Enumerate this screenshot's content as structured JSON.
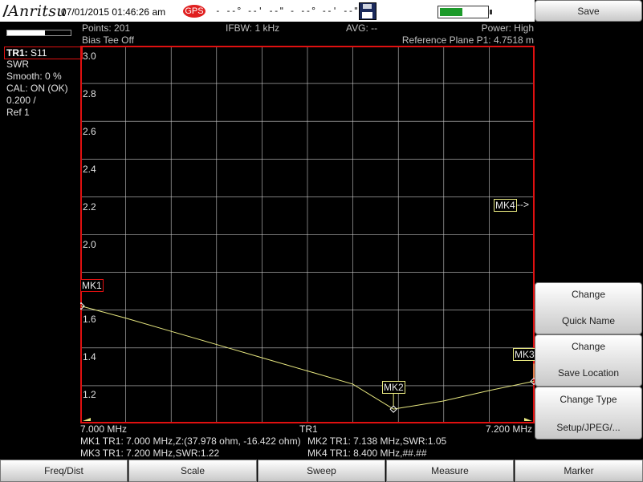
{
  "header": {
    "logo": "Anritsu",
    "datetime": "07/01/2015 01:46:26 am",
    "gps_label": "GPS",
    "coordinates": "- --° --' --\" - --° --' --\"",
    "battery_level": 0.5
  },
  "status": {
    "points": "Points: 201",
    "ifbw": "IFBW: 1 kHz",
    "avg": "AVG: --",
    "power": "Power: High",
    "bias_tee": "Bias Tee Off",
    "reference_plane": "Reference Plane P1: 4.7518 m",
    "progress": 0.6
  },
  "trace_info": {
    "trace": "TR1:",
    "param": "S11",
    "format": "SWR",
    "smooth": "Smooth: 0 %",
    "cal": "CAL: ON (OK)",
    "scale": "0.200 /",
    "ref": "Ref 1"
  },
  "chart_data": {
    "type": "line",
    "x": [
      7.0,
      7.02,
      7.04,
      7.06,
      7.08,
      7.1,
      7.12,
      7.138,
      7.16,
      7.18,
      7.2
    ],
    "series": [
      {
        "values": [
          1.62,
          1.555,
          1.485,
          1.415,
          1.345,
          1.275,
          1.205,
          1.072,
          1.115,
          1.17,
          1.22
        ]
      }
    ],
    "yticks": [
      "3.0",
      "2.8",
      "2.6",
      "2.4",
      "2.2",
      "2.0",
      "1.6",
      "1.4",
      "1.2"
    ],
    "ylim": [
      1.0,
      3.0
    ],
    "xlim": [
      7.0,
      7.2
    ],
    "x_start_label": "7.000 MHz",
    "x_end_label": "7.200 MHz",
    "trace_label": "TR1",
    "grid": true,
    "trace_color": "#e8e880",
    "grid_color": "#c8c8c8",
    "border_color": "#e01010"
  },
  "markers": {
    "mk1": {
      "label": "MK1",
      "x": 7.0,
      "y": 1.62
    },
    "mk2": {
      "label": "MK2",
      "x": 7.138,
      "y": 1.072
    },
    "mk3": {
      "label": "MK3",
      "x": 7.2,
      "y": 1.22
    },
    "mk4": {
      "label": "MK4",
      "arrow": "-->"
    }
  },
  "marker_readout": {
    "line1a": "MK1 TR1:  7.000 MHz,Z:(37.978 ohm, -16.422 ohm)",
    "line1b": "MK2 TR1:  7.138 MHz,SWR:1.05",
    "line2a": "MK3 TR1:  7.200 MHz,SWR:1.22",
    "line2b": "MK4 TR1:  8.400 MHz,##.##"
  },
  "softkeys": {
    "save": "Save",
    "change_quick_name_1": "Change",
    "change_quick_name_2": "Quick Name",
    "change_save_location_1": "Change",
    "change_save_location_2": "Save Location",
    "change_type_1": "Change Type",
    "change_type_2": "Setup/JPEG/..."
  },
  "bottom_menu": {
    "freq_dist": "Freq/Dist",
    "scale": "Scale",
    "sweep": "Sweep",
    "measure": "Measure",
    "marker": "Marker"
  }
}
